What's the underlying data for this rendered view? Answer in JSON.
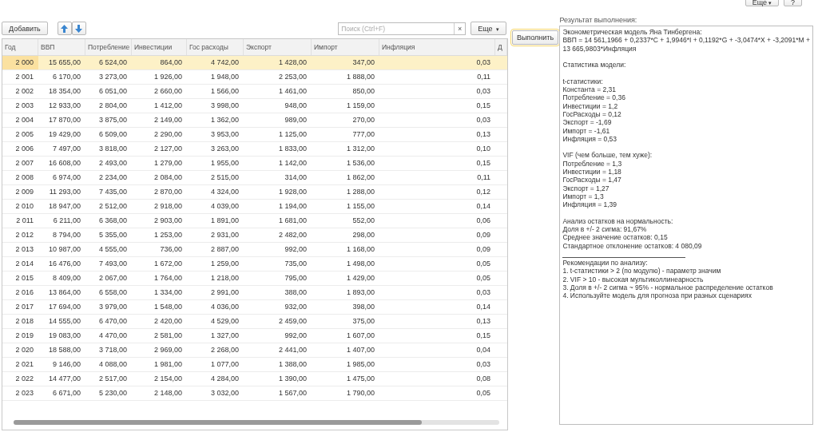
{
  "top_buttons": [
    {
      "label": "Еще",
      "kind": "menu",
      "caret": "▾"
    },
    {
      "label": "?",
      "kind": "plain"
    }
  ],
  "toolbar": {
    "add_button": "Добавить",
    "search": {
      "placeholder": "Поиск (Ctrl+F)",
      "clear": "×"
    },
    "more_button": "Еще",
    "more_caret": "▾"
  },
  "table": {
    "columns": [
      "Год",
      "ВВП",
      "Потребление",
      "Инвестиции",
      "Гос расходы",
      "Экспорт",
      "Импорт",
      "Инфляция",
      "Д"
    ],
    "rows": [
      {
        "selected": true,
        "cells": [
          "2 000",
          "15 655,00",
          "6 524,00",
          "864,00",
          "4 742,00",
          "1 428,00",
          "347,00",
          "0,03"
        ]
      },
      {
        "selected": false,
        "cells": [
          "2 001",
          "6 170,00",
          "3 273,00",
          "1 926,00",
          "1 948,00",
          "2 253,00",
          "1 888,00",
          "0,11"
        ]
      },
      {
        "selected": false,
        "cells": [
          "2 002",
          "18 354,00",
          "6 051,00",
          "2 660,00",
          "1 566,00",
          "1 461,00",
          "850,00",
          "0,03"
        ]
      },
      {
        "selected": false,
        "cells": [
          "2 003",
          "12 933,00",
          "2 804,00",
          "1 412,00",
          "3 998,00",
          "948,00",
          "1 159,00",
          "0,15"
        ]
      },
      {
        "selected": false,
        "cells": [
          "2 004",
          "17 870,00",
          "3 875,00",
          "2 149,00",
          "1 362,00",
          "989,00",
          "270,00",
          "0,03"
        ]
      },
      {
        "selected": false,
        "cells": [
          "2 005",
          "19 429,00",
          "6 509,00",
          "2 290,00",
          "3 953,00",
          "1 125,00",
          "777,00",
          "0,13"
        ]
      },
      {
        "selected": false,
        "cells": [
          "2 006",
          "7 497,00",
          "3 818,00",
          "2 127,00",
          "3 263,00",
          "1 833,00",
          "1 312,00",
          "0,10"
        ]
      },
      {
        "selected": false,
        "cells": [
          "2 007",
          "16 608,00",
          "2 493,00",
          "1 279,00",
          "1 955,00",
          "1 142,00",
          "1 536,00",
          "0,15"
        ]
      },
      {
        "selected": false,
        "cells": [
          "2 008",
          "6 974,00",
          "2 234,00",
          "2 084,00",
          "2 515,00",
          "314,00",
          "1 862,00",
          "0,11"
        ]
      },
      {
        "selected": false,
        "cells": [
          "2 009",
          "11 293,00",
          "7 435,00",
          "2 870,00",
          "4 324,00",
          "1 928,00",
          "1 288,00",
          "0,12"
        ]
      },
      {
        "selected": false,
        "cells": [
          "2 010",
          "18 947,00",
          "2 512,00",
          "2 918,00",
          "4 039,00",
          "1 194,00",
          "1 155,00",
          "0,14"
        ]
      },
      {
        "selected": false,
        "cells": [
          "2 011",
          "6 211,00",
          "6 368,00",
          "2 903,00",
          "1 891,00",
          "1 681,00",
          "552,00",
          "0,06"
        ]
      },
      {
        "selected": false,
        "cells": [
          "2 012",
          "8 794,00",
          "5 355,00",
          "1 253,00",
          "2 931,00",
          "2 482,00",
          "298,00",
          "0,09"
        ]
      },
      {
        "selected": false,
        "cells": [
          "2 013",
          "10 987,00",
          "4 555,00",
          "736,00",
          "2 887,00",
          "992,00",
          "1 168,00",
          "0,09"
        ]
      },
      {
        "selected": false,
        "cells": [
          "2 014",
          "16 476,00",
          "7 493,00",
          "1 672,00",
          "1 259,00",
          "735,00",
          "1 498,00",
          "0,05"
        ]
      },
      {
        "selected": false,
        "cells": [
          "2 015",
          "8 409,00",
          "2 067,00",
          "1 764,00",
          "1 218,00",
          "795,00",
          "1 429,00",
          "0,05"
        ]
      },
      {
        "selected": false,
        "cells": [
          "2 016",
          "13 864,00",
          "6 558,00",
          "1 334,00",
          "2 991,00",
          "388,00",
          "1 893,00",
          "0,03"
        ]
      },
      {
        "selected": false,
        "cells": [
          "2 017",
          "17 694,00",
          "3 979,00",
          "1 548,00",
          "4 036,00",
          "932,00",
          "398,00",
          "0,14"
        ]
      },
      {
        "selected": false,
        "cells": [
          "2 018",
          "14 555,00",
          "6 470,00",
          "2 420,00",
          "4 529,00",
          "2 459,00",
          "375,00",
          "0,13"
        ]
      },
      {
        "selected": false,
        "cells": [
          "2 019",
          "19 083,00",
          "4 470,00",
          "2 581,00",
          "1 327,00",
          "992,00",
          "1 607,00",
          "0,15"
        ]
      },
      {
        "selected": false,
        "cells": [
          "2 020",
          "18 588,00",
          "3 718,00",
          "2 969,00",
          "2 268,00",
          "2 441,00",
          "1 407,00",
          "0,04"
        ]
      },
      {
        "selected": false,
        "cells": [
          "2 021",
          "9 146,00",
          "4 088,00",
          "1 981,00",
          "1 077,00",
          "1 388,00",
          "1 985,00",
          "0,03"
        ]
      },
      {
        "selected": false,
        "cells": [
          "2 022",
          "14 477,00",
          "2 517,00",
          "2 154,00",
          "4 284,00",
          "1 390,00",
          "1 475,00",
          "0,08"
        ]
      },
      {
        "selected": false,
        "cells": [
          "2 023",
          "6 671,00",
          "5 230,00",
          "2 148,00",
          "3 032,00",
          "1 567,00",
          "1 790,00",
          "0,05"
        ]
      }
    ]
  },
  "run_button": "Выполнить",
  "result": {
    "label": "Результат выполнения:",
    "lines": [
      {
        "kind": "text",
        "text": "Эконометрическая модель Яна Тинбергена:"
      },
      {
        "kind": "text",
        "text": "ВВП = 14 561,1966 + 0,2337*C + 1,9946*I + 0,1192*G + -3,0474*X + -3,2091*M +"
      },
      {
        "kind": "text",
        "text": "13 665,9803*Инфляция"
      },
      {
        "kind": "blank"
      },
      {
        "kind": "text",
        "text": "Статистика модели:"
      },
      {
        "kind": "blank"
      },
      {
        "kind": "text",
        "text": "t-статистики:"
      },
      {
        "kind": "text",
        "text": "Константа = 2,31"
      },
      {
        "kind": "text",
        "text": "Потребление = 0,36"
      },
      {
        "kind": "text",
        "text": "Инвестиции = 1,2"
      },
      {
        "kind": "text",
        "text": "ГосРасходы = 0,12"
      },
      {
        "kind": "text",
        "text": "Экспорт = -1,69"
      },
      {
        "kind": "text",
        "text": "Импорт = -1,61"
      },
      {
        "kind": "text",
        "text": "Инфляция = 0,53"
      },
      {
        "kind": "blank"
      },
      {
        "kind": "text",
        "text": "VIF (чем больше, тем хуже):"
      },
      {
        "kind": "text",
        "text": "Потребление = 1,3"
      },
      {
        "kind": "text",
        "text": "Инвестиции = 1,18"
      },
      {
        "kind": "text",
        "text": "ГосРасходы = 1,47"
      },
      {
        "kind": "text",
        "text": "Экспорт = 1,27"
      },
      {
        "kind": "text",
        "text": "Импорт = 1,3"
      },
      {
        "kind": "text",
        "text": "Инфляция = 1,39"
      },
      {
        "kind": "blank"
      },
      {
        "kind": "text",
        "text": "Анализ остатков на нормальность:"
      },
      {
        "kind": "text",
        "text": "Доля в +/- 2 сигма: 91,67%"
      },
      {
        "kind": "text",
        "text": "Среднее значение остатков: 0,15"
      },
      {
        "kind": "text",
        "text": "Стандартное отклонение остатков: 4 080,09"
      },
      {
        "kind": "rule"
      },
      {
        "kind": "text",
        "text": "Рекомендации по анализу:"
      },
      {
        "kind": "text",
        "text": "1. t-статистики > 2 (по модулю) - параметр значим"
      },
      {
        "kind": "text",
        "text": "2. VIF > 10 - высокая мультиколлинеарность"
      },
      {
        "kind": "text",
        "text": "3. Доля в +/- 2 сигма ~ 95% - нормальное распределение остатков"
      },
      {
        "kind": "text",
        "text": "4. Используйте модель для прогноза при разных сценариях"
      }
    ]
  }
}
